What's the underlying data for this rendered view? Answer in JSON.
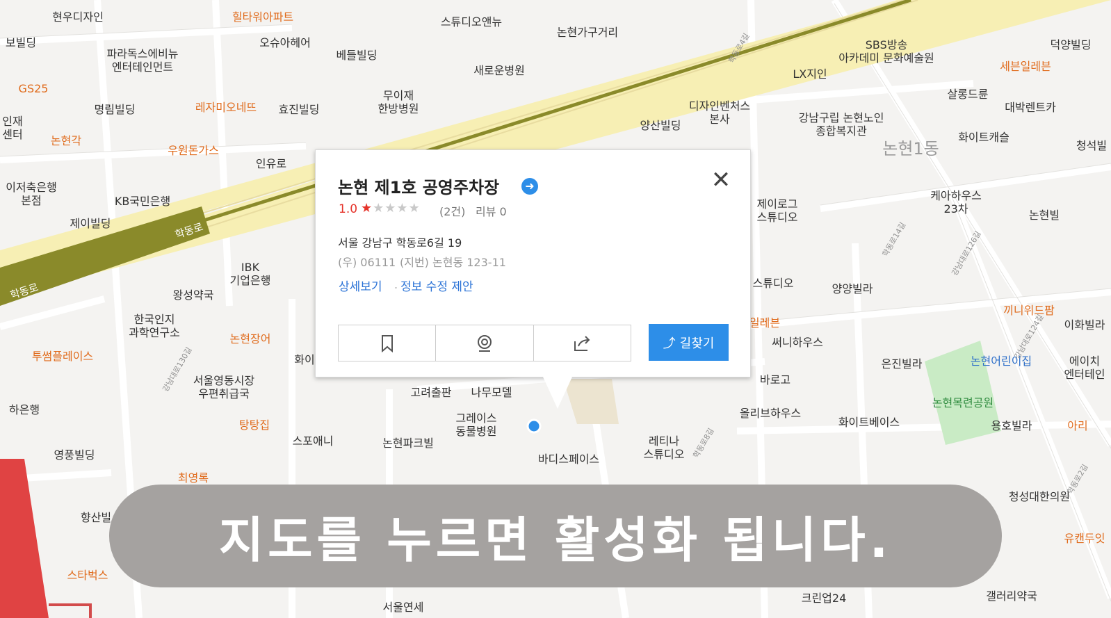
{
  "map": {
    "labels": [
      {
        "text": "현우디자인",
        "type": "poi"
      },
      {
        "text": "힐타워아파트",
        "type": "food"
      },
      {
        "text": "스튜디오앤뉴",
        "type": "poi"
      },
      {
        "text": "논현가구거리",
        "type": "poi"
      },
      {
        "text": "보빌딩",
        "type": "poi"
      },
      {
        "text": "파라독스에비뉴\n엔터테인먼트",
        "type": "poi"
      },
      {
        "text": "오슈아헤어",
        "type": "poi"
      },
      {
        "text": "베들빌딩",
        "type": "poi"
      },
      {
        "text": "새로운병원",
        "type": "poi"
      },
      {
        "text": "SBS방송\n아카데미 문화예술원",
        "type": "poi"
      },
      {
        "text": "덕양빌딩",
        "type": "poi"
      },
      {
        "text": "세븐일레븐",
        "type": "food"
      },
      {
        "text": "LX지인",
        "type": "poi"
      },
      {
        "text": "GS25",
        "type": "food"
      },
      {
        "text": "명림빌딩",
        "type": "poi"
      },
      {
        "text": "레자미오네뜨",
        "type": "food"
      },
      {
        "text": "효진빌딩",
        "type": "poi"
      },
      {
        "text": "무이재\n한방병원",
        "type": "poi"
      },
      {
        "text": "디자인벤처스\n본사",
        "type": "poi"
      },
      {
        "text": "강남구립 논현노인\n종합복지관",
        "type": "poi"
      },
      {
        "text": "살롱드륜",
        "type": "poi"
      },
      {
        "text": "대박렌트카",
        "type": "poi"
      },
      {
        "text": "인재\n센터",
        "type": "poi"
      },
      {
        "text": "논현각",
        "type": "food"
      },
      {
        "text": "우원돈가스",
        "type": "food"
      },
      {
        "text": "양산빌딩",
        "type": "poi"
      },
      {
        "text": "논현1동",
        "type": "area"
      },
      {
        "text": "화이트캐슬",
        "type": "poi"
      },
      {
        "text": "청석빌",
        "type": "poi"
      },
      {
        "text": "인유로",
        "type": "poi"
      },
      {
        "text": "이저축은행\n본점",
        "type": "poi"
      },
      {
        "text": "KB국민은행",
        "type": "poi"
      },
      {
        "text": "제이빌딩",
        "type": "poi"
      },
      {
        "text": "제이로그\n스튜디오",
        "type": "poi"
      },
      {
        "text": "케아하우스\n23차",
        "type": "poi"
      },
      {
        "text": "논현빌",
        "type": "poi"
      },
      {
        "text": "IBK\n기업은행",
        "type": "poi"
      },
      {
        "text": "왕성약국",
        "type": "poi"
      },
      {
        "text": "스튜디오",
        "type": "poi"
      },
      {
        "text": "양양빌라",
        "type": "poi"
      },
      {
        "text": "한국인지\n과학연구소",
        "type": "poi"
      },
      {
        "text": "논현장어",
        "type": "food"
      },
      {
        "text": "화이",
        "type": "poi"
      },
      {
        "text": "일레븐",
        "type": "food"
      },
      {
        "text": "써니하우스",
        "type": "poi"
      },
      {
        "text": "끼니위드팜",
        "type": "food"
      },
      {
        "text": "이화빌라",
        "type": "poi"
      },
      {
        "text": "투썸플레이스",
        "type": "food"
      },
      {
        "text": "은진빌라",
        "type": "poi"
      },
      {
        "text": "논현어린이집",
        "type": "blue"
      },
      {
        "text": "에이치\n엔터테인",
        "type": "poi"
      },
      {
        "text": "서울영동시장\n우편취급국",
        "type": "poi"
      },
      {
        "text": "고려출판",
        "type": "poi"
      },
      {
        "text": "나무모델",
        "type": "poi"
      },
      {
        "text": "바로고",
        "type": "poi"
      },
      {
        "text": "올리브하우스",
        "type": "poi"
      },
      {
        "text": "화이트베이스",
        "type": "poi"
      },
      {
        "text": "논현목련공원",
        "type": "park"
      },
      {
        "text": "하은행",
        "type": "poi"
      },
      {
        "text": "탕탕집",
        "type": "food"
      },
      {
        "text": "그레이스\n동물병원",
        "type": "poi"
      },
      {
        "text": "용호빌라",
        "type": "poi"
      },
      {
        "text": "아리",
        "type": "food"
      },
      {
        "text": "영풍빌딩",
        "type": "poi"
      },
      {
        "text": "스포애니",
        "type": "poi"
      },
      {
        "text": "논현파크빌",
        "type": "poi"
      },
      {
        "text": "레티나\n스튜디오",
        "type": "poi"
      },
      {
        "text": "바디스페이스",
        "type": "poi"
      },
      {
        "text": "최영록",
        "type": "food"
      },
      {
        "text": "청성대한의원",
        "type": "poi"
      },
      {
        "text": "향산빌",
        "type": "poi"
      },
      {
        "text": "유캔두잇",
        "type": "food"
      },
      {
        "text": "스타벅스",
        "type": "food"
      },
      {
        "text": "크린업24",
        "type": "poi"
      },
      {
        "text": "갤러리약국",
        "type": "poi"
      },
      {
        "text": "서울연세",
        "type": "poi"
      },
      {
        "text": "학동로",
        "type": "road"
      },
      {
        "text": "학동로",
        "type": "road"
      },
      {
        "text": "학동로14길",
        "type": "road-small"
      },
      {
        "text": "강남대로126길",
        "type": "road-small"
      },
      {
        "text": "학동로4길",
        "type": "road-small"
      },
      {
        "text": "강남대로124길",
        "type": "road-small"
      },
      {
        "text": "강남대로130길",
        "type": "road-small"
      },
      {
        "text": "학동로8길",
        "type": "road-small"
      },
      {
        "text": "학동로2길",
        "type": "road-small"
      }
    ]
  },
  "popup": {
    "name": "논현 제1호 공영주차장",
    "rating": "1.0",
    "stars_filled": 1,
    "stars_total": 5,
    "rating_count": "(2건)",
    "review": "리뷰 0",
    "address": "서울 강남구 학동로6길 19",
    "zipcode": "(우) 06111",
    "jibun": "(지번) 논현동 123-11",
    "detail_link": "상세보기",
    "separator": ".",
    "edit_link": "정보 수정 제안",
    "actions": [
      "bookmark-icon",
      "roadview-icon",
      "share-icon"
    ],
    "route_button": "길찾기",
    "arrow_icon": "arrow-right-icon",
    "close_icon": "close-icon"
  },
  "overlay_text": "지도를 누르면 활성화 됩니다.",
  "colors": {
    "main_road": "#f7efb4",
    "subway_line": "#8a8a2a",
    "accent_blue": "#2d8ee8",
    "rating_red": "#e5332a",
    "food_orange": "#e06b1c"
  }
}
